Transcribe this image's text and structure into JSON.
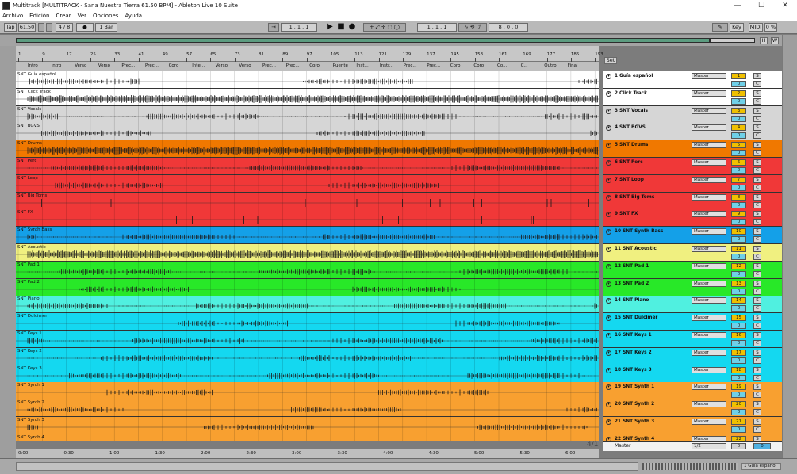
{
  "window": {
    "title": "Multitrack  [MULTITRACK - Sana Nuestra Tierra 61.50 BPM] - Ableton Live 10 Suite",
    "controls": [
      "—",
      "☐",
      "✕"
    ]
  },
  "menu": [
    "Archivo",
    "Edición",
    "Crear",
    "Ver",
    "Opciones",
    "Ayuda"
  ],
  "transport": {
    "tap": "Tap",
    "tempo": "61.50",
    "signature": "4 / 8",
    "metronome": "●",
    "quantize": "1 Bar",
    "arrangement_position": "1 . 1 . 1",
    "loop_start": "1 . 1 . 1",
    "loop_length": "8 . 0 . 0",
    "key": "Key",
    "midi": "MIDI",
    "cpu": "0 %",
    "h": "H",
    "w": "W",
    "set": "Set"
  },
  "ruler": {
    "bars": [
      "1",
      "9",
      "17",
      "25",
      "33",
      "41",
      "49",
      "57",
      "65",
      "73",
      "81",
      "89",
      "97",
      "105",
      "113",
      "121",
      "129",
      "137",
      "145",
      "153",
      "161",
      "169",
      "177",
      "185",
      "193"
    ]
  },
  "locators": [
    "Intro",
    "Intro",
    "Verso",
    "Verso",
    "Prec...",
    "Prec...",
    "Coro",
    "Inte...",
    "Verso",
    "Verso",
    "Prec...",
    "Prec...",
    "Coro",
    "Puente",
    "Inst...",
    "Instr...",
    "Prec...",
    "Prec...",
    "Coro",
    "Coro",
    "Co...",
    "C...",
    "Outro",
    "Final"
  ],
  "time_ruler": [
    "0:00",
    "0:30",
    "1:00",
    "1:30",
    "2:00",
    "2:30",
    "3:00",
    "3:30",
    "4:00",
    "4:30",
    "5:00",
    "5:30",
    "6:00"
  ],
  "tracks": [
    {
      "clip": "SNT Guía español",
      "header": "1 Guía español",
      "color": "#ffffff",
      "num": "1",
      "route": "Master",
      "vol": "0",
      "density": "sparse"
    },
    {
      "clip": "SNT Click Track",
      "header": "2 Click Track",
      "color": "#ffffff",
      "num": "2",
      "route": "Master",
      "vol": "0",
      "density": "dense"
    },
    {
      "clip": "SNT Vocals",
      "header": "3 SNT Vocals",
      "color": "#d6d6d6",
      "num": "3",
      "route": "Master",
      "vol": "0",
      "density": "medium"
    },
    {
      "clip": "SNT BGVS",
      "header": "4 SNT BGVS",
      "color": "#d6d6d6",
      "num": "4",
      "route": "Master",
      "vol": "0",
      "density": "sparse"
    },
    {
      "clip": "SNT Drums",
      "header": "5 SNT Drums",
      "color": "#f07800",
      "num": "5",
      "route": "Master",
      "vol": "0",
      "density": "dense"
    },
    {
      "clip": "SNT Perc",
      "header": "6 SNT Perc",
      "color": "#f03838",
      "num": "6",
      "route": "Master",
      "vol": "0",
      "density": "medium"
    },
    {
      "clip": "SNT Loop",
      "header": "7 SNT Loop",
      "color": "#f03838",
      "num": "7",
      "route": "Master",
      "vol": "0",
      "density": "sparse"
    },
    {
      "clip": "SNT Big Toms",
      "header": "8 SNT Big Toms",
      "color": "#f03838",
      "num": "8",
      "route": "Master",
      "vol": "0",
      "density": "hits"
    },
    {
      "clip": "SNT FX",
      "header": "9 SNT FX",
      "color": "#f03838",
      "num": "9",
      "route": "Master",
      "vol": "0",
      "density": "hits"
    },
    {
      "clip": "SNT Synth Bass",
      "header": "10 SNT Synth Bass",
      "color": "#14a0e8",
      "num": "10",
      "route": "Master",
      "vol": "0",
      "density": "medium"
    },
    {
      "clip": "SNT Acoustic",
      "header": "11 SNT Acoustic",
      "color": "#f0f080",
      "num": "11",
      "route": "Master",
      "vol": "0",
      "density": "dense"
    },
    {
      "clip": "SNT Pad 1",
      "header": "12 SNT Pad 1",
      "color": "#28e828",
      "num": "12",
      "route": "Master",
      "vol": "0",
      "density": "medium"
    },
    {
      "clip": "SNT Pad 2",
      "header": "13 SNT Pad 2",
      "color": "#28e828",
      "num": "13",
      "route": "Master",
      "vol": "0",
      "density": "sparse"
    },
    {
      "clip": "SNT Piano",
      "header": "14 SNT Piano",
      "color": "#50f0e0",
      "num": "14",
      "route": "Master",
      "vol": "0",
      "density": "medium"
    },
    {
      "clip": "SNT Dulcimer",
      "header": "15 SNT Dulcimer",
      "color": "#14d8f0",
      "num": "15",
      "route": "Master",
      "vol": "0",
      "density": "sparse"
    },
    {
      "clip": "SNT Keys 1",
      "header": "16 SNT Keys 1",
      "color": "#14d8f0",
      "num": "16",
      "route": "Master",
      "vol": "0",
      "density": "medium"
    },
    {
      "clip": "SNT Keys 2",
      "header": "17 SNT Keys 2",
      "color": "#14d8f0",
      "num": "17",
      "route": "Master",
      "vol": "0",
      "density": "medium"
    },
    {
      "clip": "SNT Keys 3",
      "header": "18 SNT Keys 3",
      "color": "#14d8f0",
      "num": "18",
      "route": "Master",
      "vol": "0",
      "density": "medium"
    },
    {
      "clip": "SNT Synth 1",
      "header": "19 SNT Synth 1",
      "color": "#f8a030",
      "num": "19",
      "route": "Master",
      "vol": "0",
      "density": "sparse"
    },
    {
      "clip": "SNT Synth 2",
      "header": "20 SNT Synth 2",
      "color": "#f8a030",
      "num": "20",
      "route": "Master",
      "vol": "0",
      "density": "sparse"
    },
    {
      "clip": "SNT Synth 3",
      "header": "21 SNT Synth 3",
      "color": "#f8a030",
      "num": "21",
      "route": "Master",
      "vol": "0",
      "density": "sparse"
    },
    {
      "clip": "SNT Synth 4",
      "header": "22 SNT Synth 4",
      "color": "#f8a030",
      "num": "22",
      "route": "Master",
      "vol": "0",
      "density": "sparse"
    }
  ],
  "master": {
    "name": "Master",
    "route": "1/2",
    "vol": "0",
    "pan": "0"
  },
  "page_indicator": "4/1",
  "statusbar": {
    "current_track": "1 Guía español"
  }
}
